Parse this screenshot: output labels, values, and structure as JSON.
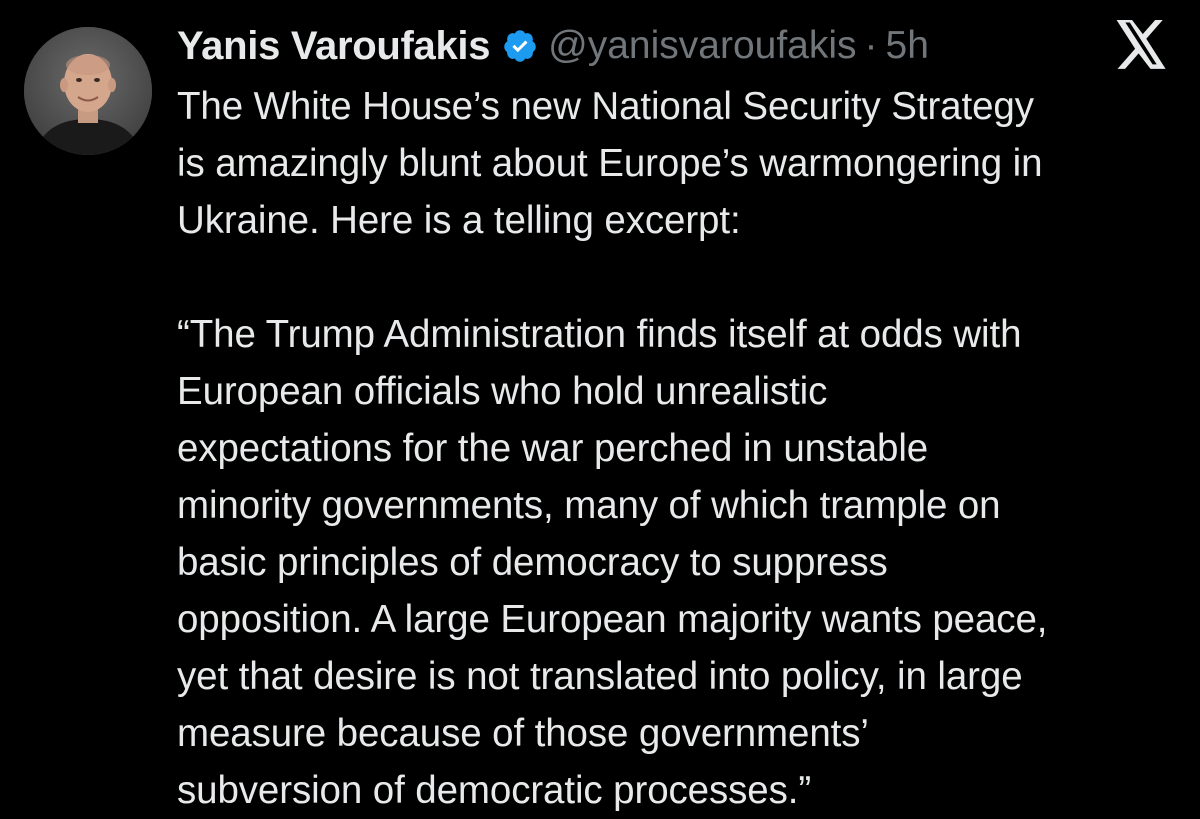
{
  "author": {
    "display_name": "Yanis Varoufakis",
    "handle": "@yanisvaroufakis",
    "separator": "·",
    "time": "5h",
    "verified": true,
    "verified_color": "#1d9bf0"
  },
  "icons": {
    "avatar": "profile-photo",
    "verified": "verified-badge-icon",
    "brand": "x-logo-icon"
  },
  "tweet": {
    "text": "The White House’s new National Security Strategy\nis amazingly blunt about Europe’s warmongering in\nUkraine. Here is a telling excerpt:\n\n“The Trump Administration finds itself at odds with\nEuropean officials who hold unrealistic\nexpectations for the war perched in unstable\nminority governments, many of which trample on\nbasic principles of democracy to suppress\nopposition. A large European majority wants peace,\nyet that desire is not translated into policy, in large\nmeasure because of those governments’\nsubversion of democratic processes.”"
  },
  "colors": {
    "background": "#000000",
    "text": "#e7e9ea",
    "muted": "#71767b"
  }
}
